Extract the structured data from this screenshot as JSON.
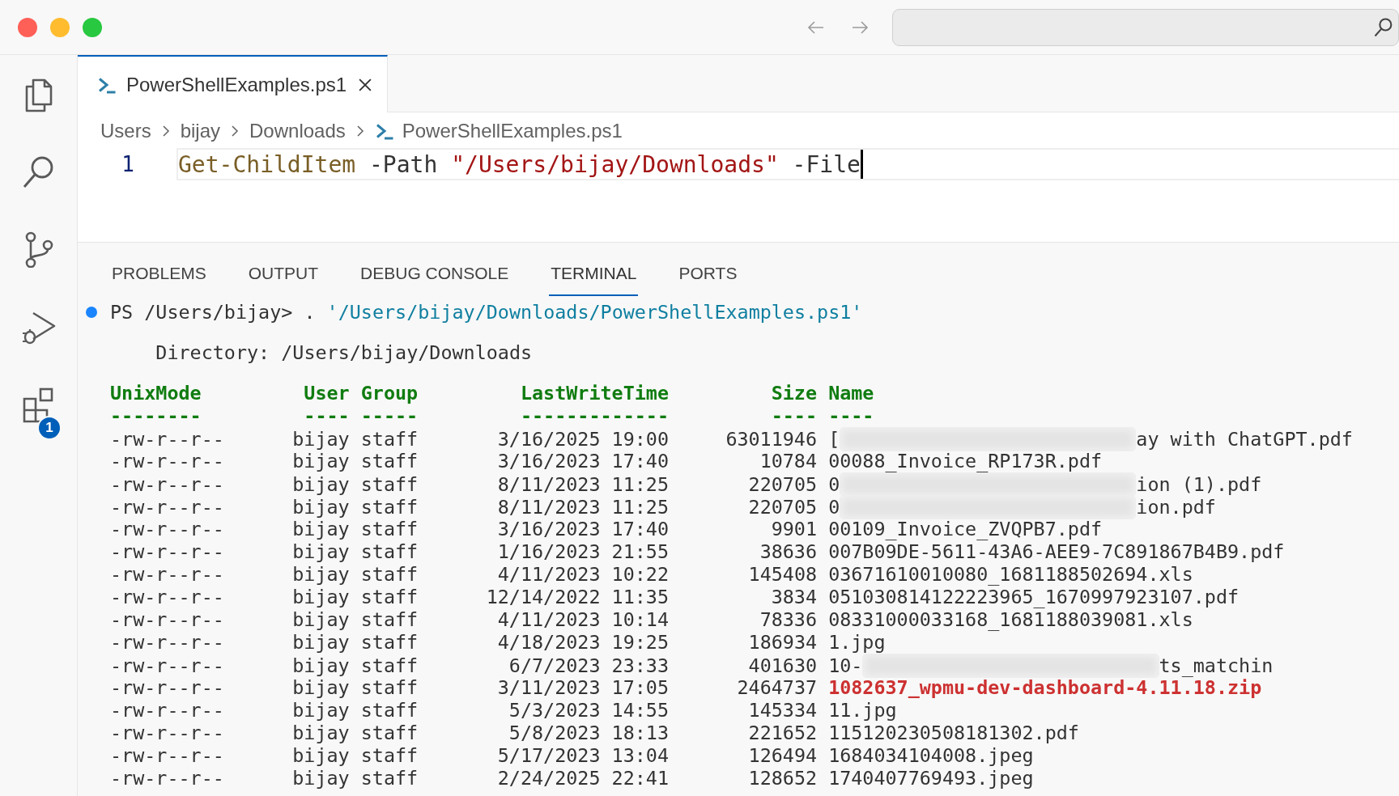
{
  "activity_bar": {
    "items": [
      {
        "kind": "explorer"
      },
      {
        "kind": "search"
      },
      {
        "kind": "source-control"
      },
      {
        "kind": "run-debug"
      },
      {
        "kind": "extensions",
        "badge": "1"
      }
    ]
  },
  "editor": {
    "tab": {
      "label": "PowerShellExamples.ps1",
      "selected": true
    },
    "breadcrumbs": [
      {
        "label": "Users",
        "kind": "folder"
      },
      {
        "label": "bijay",
        "kind": "folder"
      },
      {
        "label": "Downloads",
        "kind": "folder"
      },
      {
        "label": "PowerShellExamples.ps1",
        "kind": "powershell"
      }
    ],
    "lines": [
      {
        "number": "1",
        "tokens": [
          {
            "kind": "command",
            "text": "Get-ChildItem"
          },
          {
            "kind": "plain",
            "text": " -Path "
          },
          {
            "kind": "string",
            "text": "\"/Users/bijay/Downloads\""
          },
          {
            "kind": "plain",
            "text": " -File"
          }
        ]
      }
    ]
  },
  "panel": {
    "tabs": [
      {
        "label": "PROBLEMS",
        "selected": false
      },
      {
        "label": "OUTPUT",
        "selected": false
      },
      {
        "label": "DEBUG CONSOLE",
        "selected": false
      },
      {
        "label": "TERMINAL",
        "selected": true
      },
      {
        "label": "PORTS",
        "selected": false
      }
    ],
    "terminal": {
      "prompt": "PS /Users/bijay> . ",
      "command": "'/Users/bijay/Downloads/PowerShellExamples.ps1'",
      "directory": "Directory: /Users/bijay/Downloads",
      "columns": [
        {
          "label": "UnixMode",
          "underline": "--------"
        },
        {
          "label": "User",
          "underline": "----"
        },
        {
          "label": "Group",
          "underline": "-----"
        },
        {
          "label": "LastWriteTime",
          "underline": "-------------"
        },
        {
          "label": "Size",
          "underline": "----"
        },
        {
          "label": "Name",
          "underline": "----"
        }
      ],
      "rows": [
        {
          "mode": "-rw-r--r--",
          "user": "bijay",
          "group": "staff",
          "last_write_time": "3/16/2025 19:00",
          "size": "63011946",
          "name": "[",
          "name_end": "ay with ChatGPT.pdf",
          "kind": "file"
        },
        {
          "mode": "-rw-r--r--",
          "user": "bijay",
          "group": "staff",
          "last_write_time": "3/16/2023 17:40",
          "size": "10784",
          "name": "00088_Invoice_RP173R.pdf",
          "kind": "file"
        },
        {
          "mode": "-rw-r--r--",
          "user": "bijay",
          "group": "staff",
          "last_write_time": "8/11/2023 11:25",
          "size": "220705",
          "name": "0",
          "name_end": "ion (1).pdf",
          "kind": "file"
        },
        {
          "mode": "-rw-r--r--",
          "user": "bijay",
          "group": "staff",
          "last_write_time": "8/11/2023 11:25",
          "size": "220705",
          "name": "0",
          "name_end": "ion.pdf",
          "kind": "file"
        },
        {
          "mode": "-rw-r--r--",
          "user": "bijay",
          "group": "staff",
          "last_write_time": "3/16/2023 17:40",
          "size": "9901",
          "name": "00109_Invoice_ZVQPB7.pdf",
          "kind": "file"
        },
        {
          "mode": "-rw-r--r--",
          "user": "bijay",
          "group": "staff",
          "last_write_time": "1/16/2023 21:55",
          "size": "38636",
          "name": "007B09DE-5611-43A6-AEE9-7C891867B4B9.pdf",
          "kind": "file"
        },
        {
          "mode": "-rw-r--r--",
          "user": "bijay",
          "group": "staff",
          "last_write_time": "4/11/2023 10:22",
          "size": "145408",
          "name": "03671610010080_1681188502694.xls",
          "kind": "file"
        },
        {
          "mode": "-rw-r--r--",
          "user": "bijay",
          "group": "staff",
          "last_write_time": "12/14/2022 11:35",
          "size": "3834",
          "name": "051030814122223965_1670997923107.pdf",
          "kind": "file"
        },
        {
          "mode": "-rw-r--r--",
          "user": "bijay",
          "group": "staff",
          "last_write_time": "4/11/2023 10:14",
          "size": "78336",
          "name": "08331000033168_1681188039081.xls",
          "kind": "file"
        },
        {
          "mode": "-rw-r--r--",
          "user": "bijay",
          "group": "staff",
          "last_write_time": "4/18/2023 19:25",
          "size": "186934",
          "name": "1.jpg",
          "kind": "file"
        },
        {
          "mode": "-rw-r--r--",
          "user": "bijay",
          "group": "staff",
          "last_write_time": "6/7/2023 23:33",
          "size": "401630",
          "name": "10-",
          "name_end": "ts_matchin",
          "kind": "file"
        },
        {
          "mode": "-rw-r--r--",
          "user": "bijay",
          "group": "staff",
          "last_write_time": "3/11/2023 17:05",
          "size": "2464737",
          "name": "1082637_wpmu-dev-dashboard-4.11.18.zip",
          "kind": "archive"
        },
        {
          "mode": "-rw-r--r--",
          "user": "bijay",
          "group": "staff",
          "last_write_time": "5/3/2023 14:55",
          "size": "145334",
          "name": "11.jpg",
          "kind": "file"
        },
        {
          "mode": "-rw-r--r--",
          "user": "bijay",
          "group": "staff",
          "last_write_time": "5/8/2023 18:13",
          "size": "221652",
          "name": "115120230508181302.pdf",
          "kind": "file"
        },
        {
          "mode": "-rw-r--r--",
          "user": "bijay",
          "group": "staff",
          "last_write_time": "5/17/2023 13:04",
          "size": "126494",
          "name": "1684034104008.jpeg",
          "kind": "file"
        },
        {
          "mode": "-rw-r--r--",
          "user": "bijay",
          "group": "staff",
          "last_write_time": "2/24/2025 22:41",
          "size": "128652",
          "name": "1740407769493.jpeg",
          "kind": "file"
        }
      ]
    }
  }
}
